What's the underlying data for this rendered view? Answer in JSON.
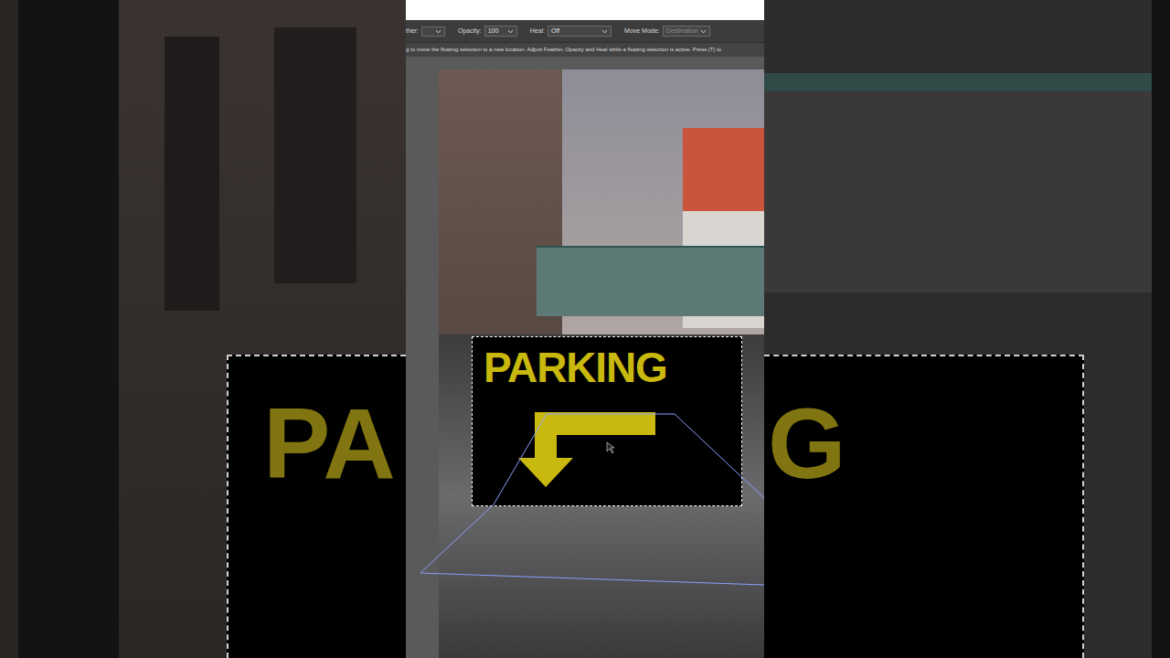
{
  "options_bar": {
    "feather": {
      "label": "ther:",
      "value": ""
    },
    "opacity": {
      "label": "Opacity:",
      "value": "100"
    },
    "heal": {
      "label": "Heal:",
      "value": "Off"
    },
    "move_mode": {
      "label": "Move Mode:",
      "value": "Destination",
      "disabled": true
    }
  },
  "hint": "g to move the floating selection to a new location. Adjust Feather, Opacity and Heal while a floating selection is active. Press (T) to",
  "canvas": {
    "floating_selection": {
      "label": "PARKING",
      "selected": true
    }
  },
  "background": {
    "left_text": "PA",
    "right_text": "G"
  }
}
